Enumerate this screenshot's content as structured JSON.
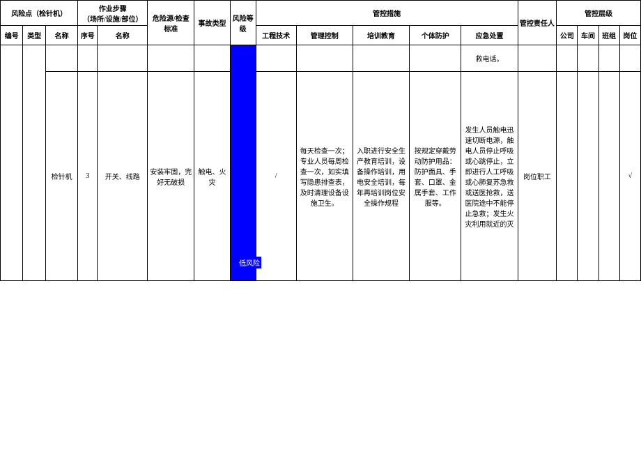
{
  "header": {
    "risk_point": "风险点（检针机）",
    "steps": "作业步骤\n（场所/设施/部位）",
    "hazard": "危险源/检查标准",
    "accident": "事故类型",
    "risk_level": "风险等级",
    "measures": "管控措施",
    "responsible": "管控责任人",
    "control_level": "管控层级"
  },
  "sub": {
    "bh": "编号",
    "lx": "类型",
    "mc": "名称",
    "xh": "序号",
    "bz": "名称",
    "gc": "工程技术",
    "gl": "管理控制",
    "px": "培训教育",
    "gt": "个体防护",
    "yj": "应急处置",
    "gs": "公司",
    "cj": "车间",
    "bzu": "班组",
    "gw": "岗位"
  },
  "cont": {
    "yj": "救电话。"
  },
  "row": {
    "mc": "检针机",
    "xh": "3",
    "bz": "开关、线路",
    "wx": "安装牢固，完好无破损",
    "sg": "触电、火灾",
    "fx": "低风险",
    "gc": "/",
    "gl": "每天检查一次；专业人员每周检查一次，如实填写隐患排查表，及时清理设备设施卫生。",
    "px": "入职进行安全生产教育培训，设备操作培训，用电安全培训，每年再培训岗位安全操作规程",
    "gt": "按规定穿戴劳动防护用品：防护面具、手套、口罩、金属手套、工作服等。",
    "yj": "发生人员触电迅速切断电源，触电人员停止呼吸或心跳停止，立即进行人工呼吸或心肺复苏急救或送医抢救，送医院途中不能停止急救；发生火灾利用就近的灭",
    "zr": "岗位职工",
    "gw": "√"
  }
}
